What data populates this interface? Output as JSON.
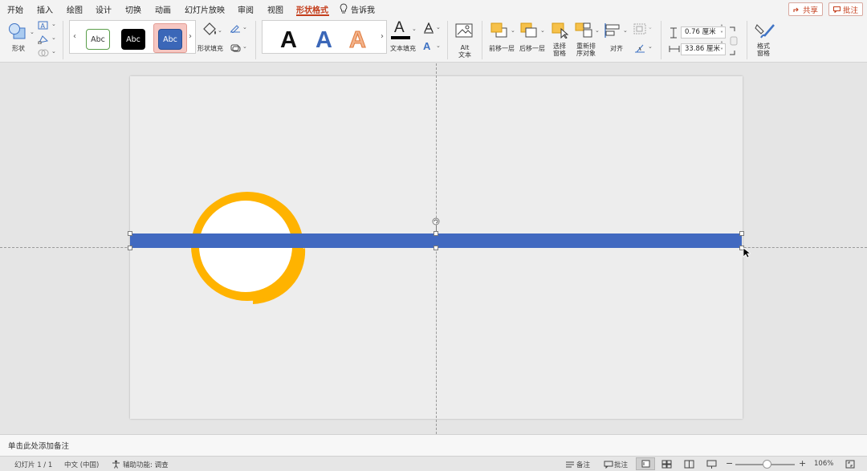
{
  "tabs": [
    "开始",
    "插入",
    "绘图",
    "设计",
    "切换",
    "动画",
    "幻灯片放映",
    "审阅",
    "视图",
    "形状格式",
    "告诉我"
  ],
  "active_tab": "形状格式",
  "share_label": "共享",
  "comment_label": "批注",
  "ribbon": {
    "shapes_label": "形状",
    "style_samples": [
      "Abc",
      "Abc",
      "Abc"
    ],
    "fill_label": "形状填充",
    "wordart_glyph": "A",
    "text_fill_label": "文本填充",
    "alt_text_label": "Alt 文本",
    "bring_forward_label": "前移一层",
    "send_backward_label": "后移一层",
    "selection_pane_label": "选择窗格",
    "reorder_label": "重新排序对象",
    "align_label": "对齐",
    "height_value": "0.76 厘米",
    "width_value": "33.86 厘米",
    "format_pane_label": "格式窗格"
  },
  "notes_placeholder": "单击此处添加备注",
  "status": {
    "slide_indicator": "幻灯片 1 / 1",
    "language": "中文 (中国)",
    "accessibility": "辅助功能: 调查",
    "notes": "备注",
    "comments": "批注",
    "zoom": "106%"
  },
  "colors": {
    "accent": "#c43e1c",
    "bar": "#4169c0",
    "ring": "#ffb300"
  }
}
